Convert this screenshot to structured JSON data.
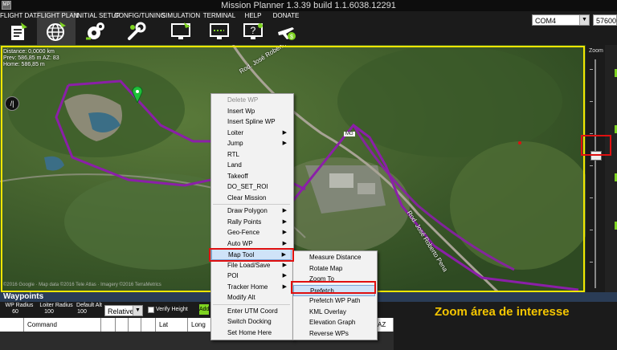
{
  "window": {
    "title": "Mission Planner 1.3.39 build 1.1.6038.12291",
    "app_icon_text": "MP"
  },
  "nav": [
    {
      "label": "FLIGHT DATA",
      "icon": "flight-data-icon"
    },
    {
      "label": "FLIGHT PLAN",
      "icon": "globe-icon"
    },
    {
      "label": "INITIAL SETUP",
      "icon": "initial-setup-icon"
    },
    {
      "label": "CONFIG/TUNING",
      "icon": "wrench-icon"
    },
    {
      "label": "SIMULATION",
      "icon": "simulation-monitor-icon"
    },
    {
      "label": "TERMINAL",
      "icon": "terminal-icon"
    },
    {
      "label": "HELP",
      "icon": "help-icon"
    },
    {
      "label": "DONATE",
      "icon": "donate-plane-icon"
    }
  ],
  "connection": {
    "port": "COM4",
    "baud": "57600"
  },
  "map": {
    "distance": "Distance: 0,0000 km",
    "prev": "Prev: 586,85 m AZ: 83",
    "home": "Home: 586,85 m",
    "copyright": "©2016 Google · Map data ©2016 Tele Atlas · Imagery ©2016 TerraMetrics",
    "road_label_top": "Rod. José Roberto Pena",
    "road_label_right": "Rod. José Roberto Pena",
    "road_sign": "MG",
    "compass": "/|"
  },
  "zoom": {
    "title": "Zoom",
    "level": 0.42
  },
  "context_menu": {
    "items": [
      {
        "label": "Delete WP",
        "enabled": false,
        "submenu": false
      },
      {
        "label": "Insert Wp",
        "enabled": true,
        "submenu": false
      },
      {
        "label": "Insert Spline WP",
        "enabled": true,
        "submenu": false
      },
      {
        "label": "Loiter",
        "enabled": true,
        "submenu": true
      },
      {
        "label": "Jump",
        "enabled": true,
        "submenu": true
      },
      {
        "label": "RTL",
        "enabled": true,
        "submenu": false
      },
      {
        "label": "Land",
        "enabled": true,
        "submenu": false
      },
      {
        "label": "Takeoff",
        "enabled": true,
        "submenu": false
      },
      {
        "label": "DO_SET_ROI",
        "enabled": true,
        "submenu": false
      },
      {
        "label": "Clear Mission",
        "enabled": true,
        "submenu": false
      },
      {
        "label": "Draw Polygon",
        "enabled": true,
        "submenu": true
      },
      {
        "label": "Rally Points",
        "enabled": true,
        "submenu": true
      },
      {
        "label": "Geo-Fence",
        "enabled": true,
        "submenu": true
      },
      {
        "label": "Auto WP",
        "enabled": true,
        "submenu": true
      },
      {
        "label": "Map Tool",
        "enabled": true,
        "submenu": true
      },
      {
        "label": "File Load/Save",
        "enabled": true,
        "submenu": true
      },
      {
        "label": "POI",
        "enabled": true,
        "submenu": true
      },
      {
        "label": "Tracker Home",
        "enabled": true,
        "submenu": true
      },
      {
        "label": "Modify Alt",
        "enabled": true,
        "submenu": false
      },
      {
        "label": "Enter UTM Coord",
        "enabled": true,
        "submenu": false
      },
      {
        "label": "Switch Docking",
        "enabled": true,
        "submenu": false
      },
      {
        "label": "Set Home Here",
        "enabled": true,
        "submenu": false
      }
    ]
  },
  "map_tool_menu": {
    "items": [
      {
        "label": "Measure Distance"
      },
      {
        "label": "Rotate Map"
      },
      {
        "label": "Zoom To"
      },
      {
        "label": "Prefetch"
      },
      {
        "label": "Prefetch WP Path"
      },
      {
        "label": "KML Overlay"
      },
      {
        "label": "Elevation Graph"
      },
      {
        "label": "Reverse WPs"
      }
    ]
  },
  "waypoints": {
    "title": "Waypoints",
    "wp_radius_label": "WP Radius",
    "wp_radius": "60",
    "loiter_radius_label": "Loiter Radius",
    "loiter_radius": "100",
    "default_alt_label": "Default Alt",
    "default_alt": "100",
    "altitude_mode": "Relative",
    "verify_height_label": "Verify Height",
    "add_below_label": "Add",
    "columns": [
      "",
      "Command",
      "",
      "",
      "",
      "",
      "Lat",
      "Long",
      "",
      "",
      "",
      "",
      "",
      "AZ"
    ]
  },
  "annotation": {
    "caption": "Zoom área de interesse"
  },
  "colors": {
    "accent_highlight": "#f2e600",
    "red_annotation": "#e01010",
    "flight_path": "#8b1fa8",
    "caption": "#f5c600",
    "waypoints_bar": "#2a3c56"
  }
}
